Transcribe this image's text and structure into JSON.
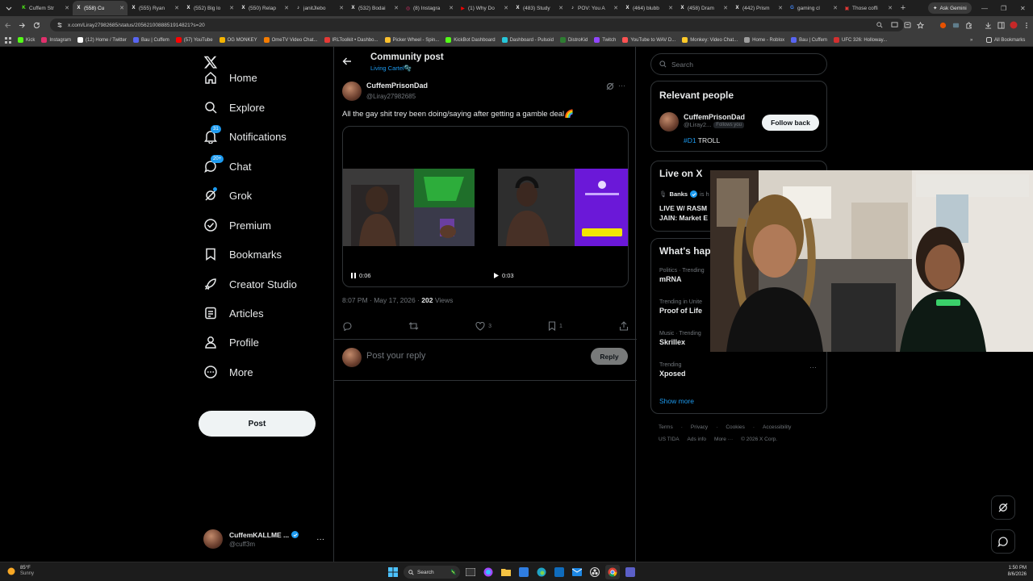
{
  "browser": {
    "tabs": [
      {
        "title": "Cuffem Str",
        "color": "#53fc18",
        "glyph": "K",
        "active": false
      },
      {
        "title": "(558) Cu",
        "color": "#ffffff",
        "glyph": "X",
        "active": true
      },
      {
        "title": "(555) Ryan",
        "color": "#ffffff",
        "glyph": "X",
        "active": false
      },
      {
        "title": "(552) Big lo",
        "color": "#ffffff",
        "glyph": "X",
        "active": false
      },
      {
        "title": "(550) Relap",
        "color": "#ffffff",
        "glyph": "X",
        "active": false
      },
      {
        "title": "janitJlebo",
        "color": "#ffffff",
        "glyph": "♪",
        "active": false
      },
      {
        "title": "(532) Bodai",
        "color": "#ffffff",
        "glyph": "X",
        "active": false
      },
      {
        "title": "(8) Instagra",
        "color": "#e1306c",
        "glyph": "◎",
        "active": false
      },
      {
        "title": "(1) Why Do",
        "color": "#ff0000",
        "glyph": "▶",
        "active": false
      },
      {
        "title": "(483) Study",
        "color": "#ffffff",
        "glyph": "X",
        "active": false
      },
      {
        "title": "POV: You A",
        "color": "#ffffff",
        "glyph": "♪",
        "active": false
      },
      {
        "title": "(464) blubb",
        "color": "#ffffff",
        "glyph": "X",
        "active": false
      },
      {
        "title": "(458) Dram",
        "color": "#ffffff",
        "glyph": "X",
        "active": false
      },
      {
        "title": "(442) Prism",
        "color": "#ffffff",
        "glyph": "X",
        "active": false
      },
      {
        "title": "gaming cl",
        "color": "#4285f4",
        "glyph": "G",
        "active": false
      },
      {
        "title": "Those coffi",
        "color": "#e53935",
        "glyph": "▣",
        "active": false
      }
    ],
    "ask_gemini": "Ask Gemini",
    "url": "x.com/Liray27982685/status/2056210088851914821?s=20",
    "bookmarks": [
      {
        "label": "Kick",
        "color": "#53fc18"
      },
      {
        "label": "Instagram",
        "color": "#e1306c"
      },
      {
        "label": "(12) Home / Twitter",
        "color": "#ffffff"
      },
      {
        "label": "Bau | Cuffem",
        "color": "#5865f2"
      },
      {
        "label": "(57) YouTube",
        "color": "#ff0000"
      },
      {
        "label": "OG MONKEY",
        "color": "#f4b400"
      },
      {
        "label": "OmeTV Video Chat...",
        "color": "#f57c00"
      },
      {
        "label": "IRLToolkit • Dashbo...",
        "color": "#e53935"
      },
      {
        "label": "Picker Wheel - Spin...",
        "color": "#fbc02d"
      },
      {
        "label": "KickBot Dashboard",
        "color": "#53fc18"
      },
      {
        "label": "Dashboard - Pulsoid",
        "color": "#26c6da"
      },
      {
        "label": "DistroKid",
        "color": "#2e7d32"
      },
      {
        "label": "Twitch",
        "color": "#9146ff"
      },
      {
        "label": "YouTube to WAV D...",
        "color": "#ff5252"
      },
      {
        "label": "Monkey: Video Chat...",
        "color": "#ffca28"
      },
      {
        "label": "Home - Roblox",
        "color": "#9e9e9e"
      },
      {
        "label": "Bau | Cuffem",
        "color": "#5865f2"
      },
      {
        "label": "UFC 326: Holloway...",
        "color": "#d32f2f"
      }
    ],
    "all_bookmarks": "All Bookmarks"
  },
  "nav": {
    "items": [
      {
        "label": "Home",
        "icon": "home-icon"
      },
      {
        "label": "Explore",
        "icon": "search-icon"
      },
      {
        "label": "Notifications",
        "icon": "bell-icon",
        "badge": "31"
      },
      {
        "label": "Chat",
        "icon": "chat-icon",
        "badge": "20+"
      },
      {
        "label": "Grok",
        "icon": "grok-icon"
      },
      {
        "label": "Premium",
        "icon": "premium-icon"
      },
      {
        "label": "Bookmarks",
        "icon": "bookmark-icon"
      },
      {
        "label": "Creator Studio",
        "icon": "rocket-icon"
      },
      {
        "label": "Articles",
        "icon": "article-icon"
      },
      {
        "label": "Profile",
        "icon": "person-icon"
      },
      {
        "label": "More",
        "icon": "more-icon"
      }
    ],
    "post_label": "Post",
    "account": {
      "name": "CuffemKALLME ...",
      "handle": "@cuff3m"
    }
  },
  "main": {
    "title": "Community post",
    "community": "Living Cartel🫧",
    "author": {
      "name": "CuffemPrisonDad",
      "handle": "@Liray27982685"
    },
    "text": "All the gay shit trey been doing/saying after getting a gamble deal🌈",
    "video_times": [
      "0:06",
      "0:03"
    ],
    "timestamp": "8:07 PM · May 17, 2026 · ",
    "views_count": "202",
    "views_label": " Views",
    "likes": "3",
    "bookmarks": "1",
    "reply_placeholder": "Post your reply",
    "reply_button": "Reply"
  },
  "sidebar": {
    "search_placeholder": "Search",
    "relevant_title": "Relevant people",
    "person": {
      "name": "CuffemPrisonDad",
      "handle": "@Liray2...",
      "follows_you": "Follows you",
      "bio_tag": "#D1",
      "bio_rest": " TROLL"
    },
    "follow_back": "Follow back",
    "live_title": "Live on X",
    "live_host": "Banks",
    "live_host_rest": " is h",
    "live_text": "LIVE W/ RASM",
    "live_text2": "JAIN: Market E",
    "happening_title": "What's hap",
    "trends": [
      {
        "meta": "Politics · Trending",
        "name": "mRNA"
      },
      {
        "meta": "Trending in Unite",
        "name": "Proof of Life"
      },
      {
        "meta": "Music · Trending",
        "name": "Skrillex"
      },
      {
        "meta": "Trending",
        "name": "Xposed"
      }
    ],
    "show_more": "Show more",
    "footer1": [
      "Terms",
      "Privacy",
      "Cookies",
      "Accessibility"
    ],
    "footer2": [
      "US TIDA",
      "Ads info",
      "More ···",
      "© 2026 X Corp."
    ]
  },
  "taskbar": {
    "temp": "85°F",
    "condition": "Sunny",
    "search": "Search",
    "time": "1:50 PM",
    "date": "8/6/2026"
  },
  "colors": {
    "accent": "#1d9bf0",
    "bg": "#000000",
    "border": "#2f3336",
    "muted": "#71767b"
  }
}
